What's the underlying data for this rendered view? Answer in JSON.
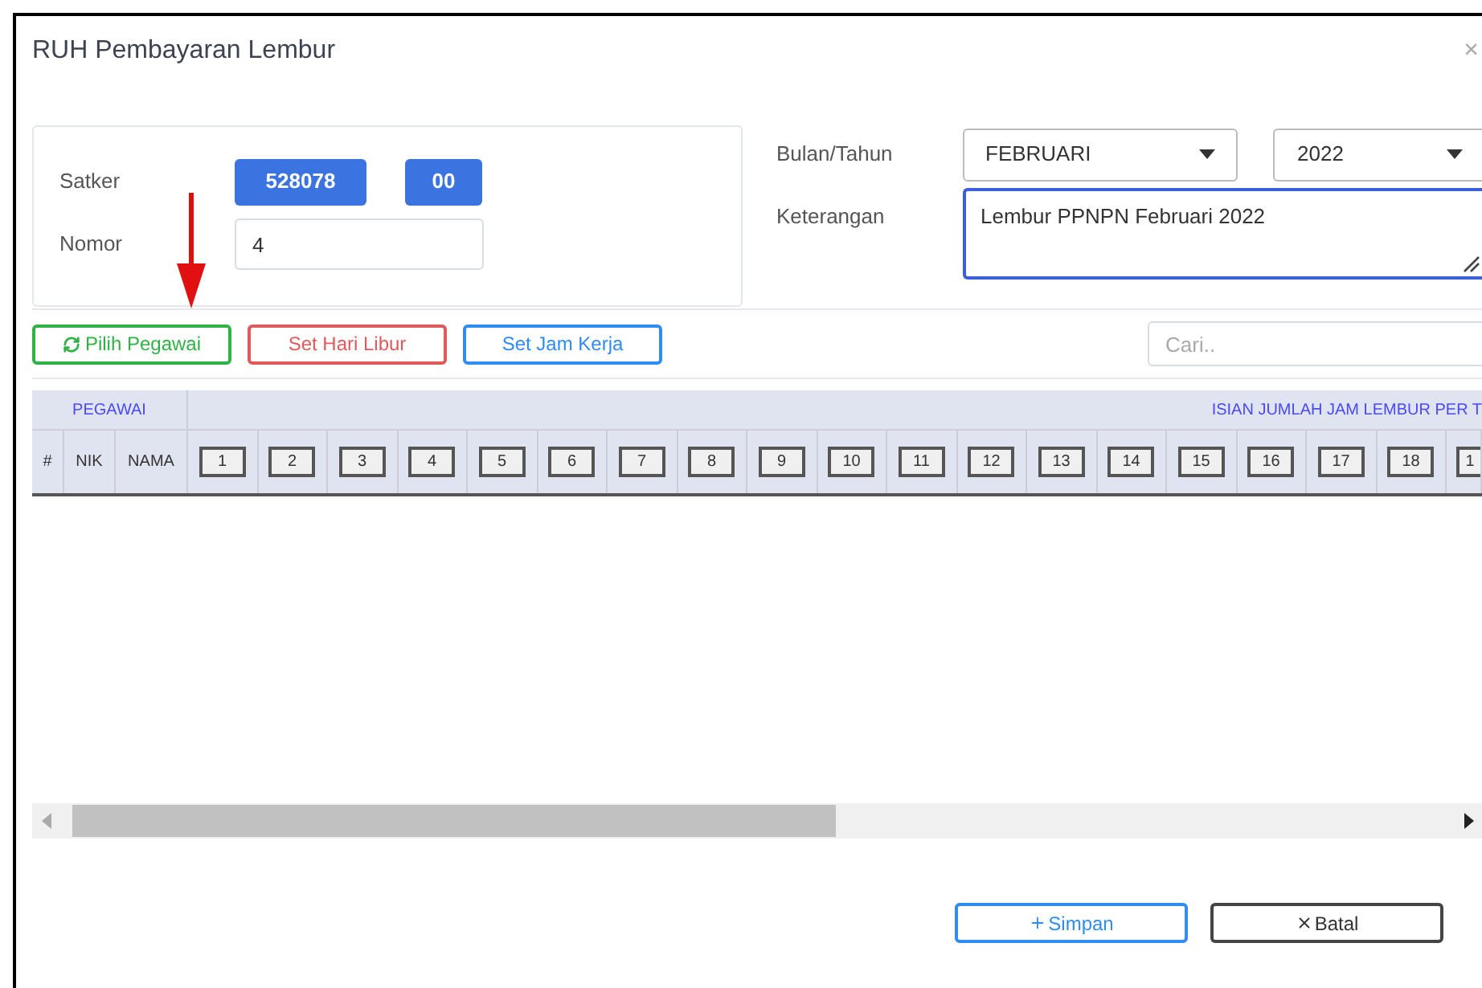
{
  "dialog": {
    "title": "RUH Pembayaran Lembur",
    "close": "×"
  },
  "form": {
    "satker_label": "Satker",
    "satker_code": "528078",
    "satker_sub": "00",
    "nomor_label": "Nomor",
    "nomor_value": "4",
    "bulan_label": "Bulan/Tahun",
    "bulan_value": "FEBRUARI",
    "tahun_value": "2022",
    "keterangan_label": "Keterangan",
    "keterangan_value": "Lembur PPNPN Februari 2022"
  },
  "toolbar": {
    "buttons": [
      {
        "label": "Pilih Pegawai",
        "kind": "green"
      },
      {
        "label": "Set Hari Libur",
        "kind": "red"
      },
      {
        "label": "Set Jam Kerja",
        "kind": "blue"
      }
    ],
    "search": {
      "placeholder": "Cari.."
    }
  },
  "table": {
    "group_left": "PEGAWAI",
    "group_right": "ISIAN JUMLAH JAM LEMBUR PER T",
    "columns": [
      "#",
      "NIK",
      "NAMA"
    ],
    "days": [
      "1",
      "2",
      "3",
      "4",
      "5",
      "6",
      "7",
      "8",
      "9",
      "10",
      "11",
      "12",
      "13",
      "14",
      "15",
      "16",
      "17",
      "18",
      "1"
    ]
  },
  "footer": {
    "buttons": [
      {
        "label": "Simpan",
        "kind": "save"
      },
      {
        "label": "Batal",
        "kind": "cancel"
      }
    ]
  }
}
